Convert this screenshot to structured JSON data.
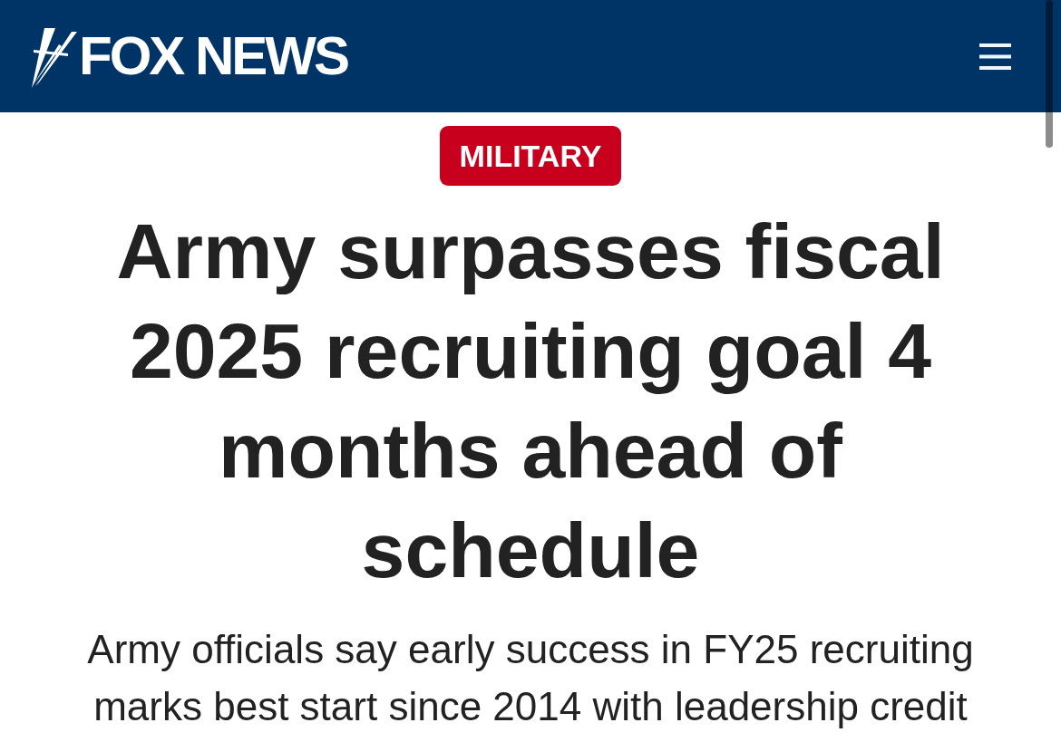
{
  "header": {
    "logo": {
      "text": "FOX NEWS"
    }
  },
  "article": {
    "category": "MILITARY",
    "headline": "Army surpasses fiscal 2025 recruiting goal 4 months ahead of schedule",
    "subheadline": "Army officials say early success in FY25 recruiting marks best start since 2014 with leadership credit"
  }
}
